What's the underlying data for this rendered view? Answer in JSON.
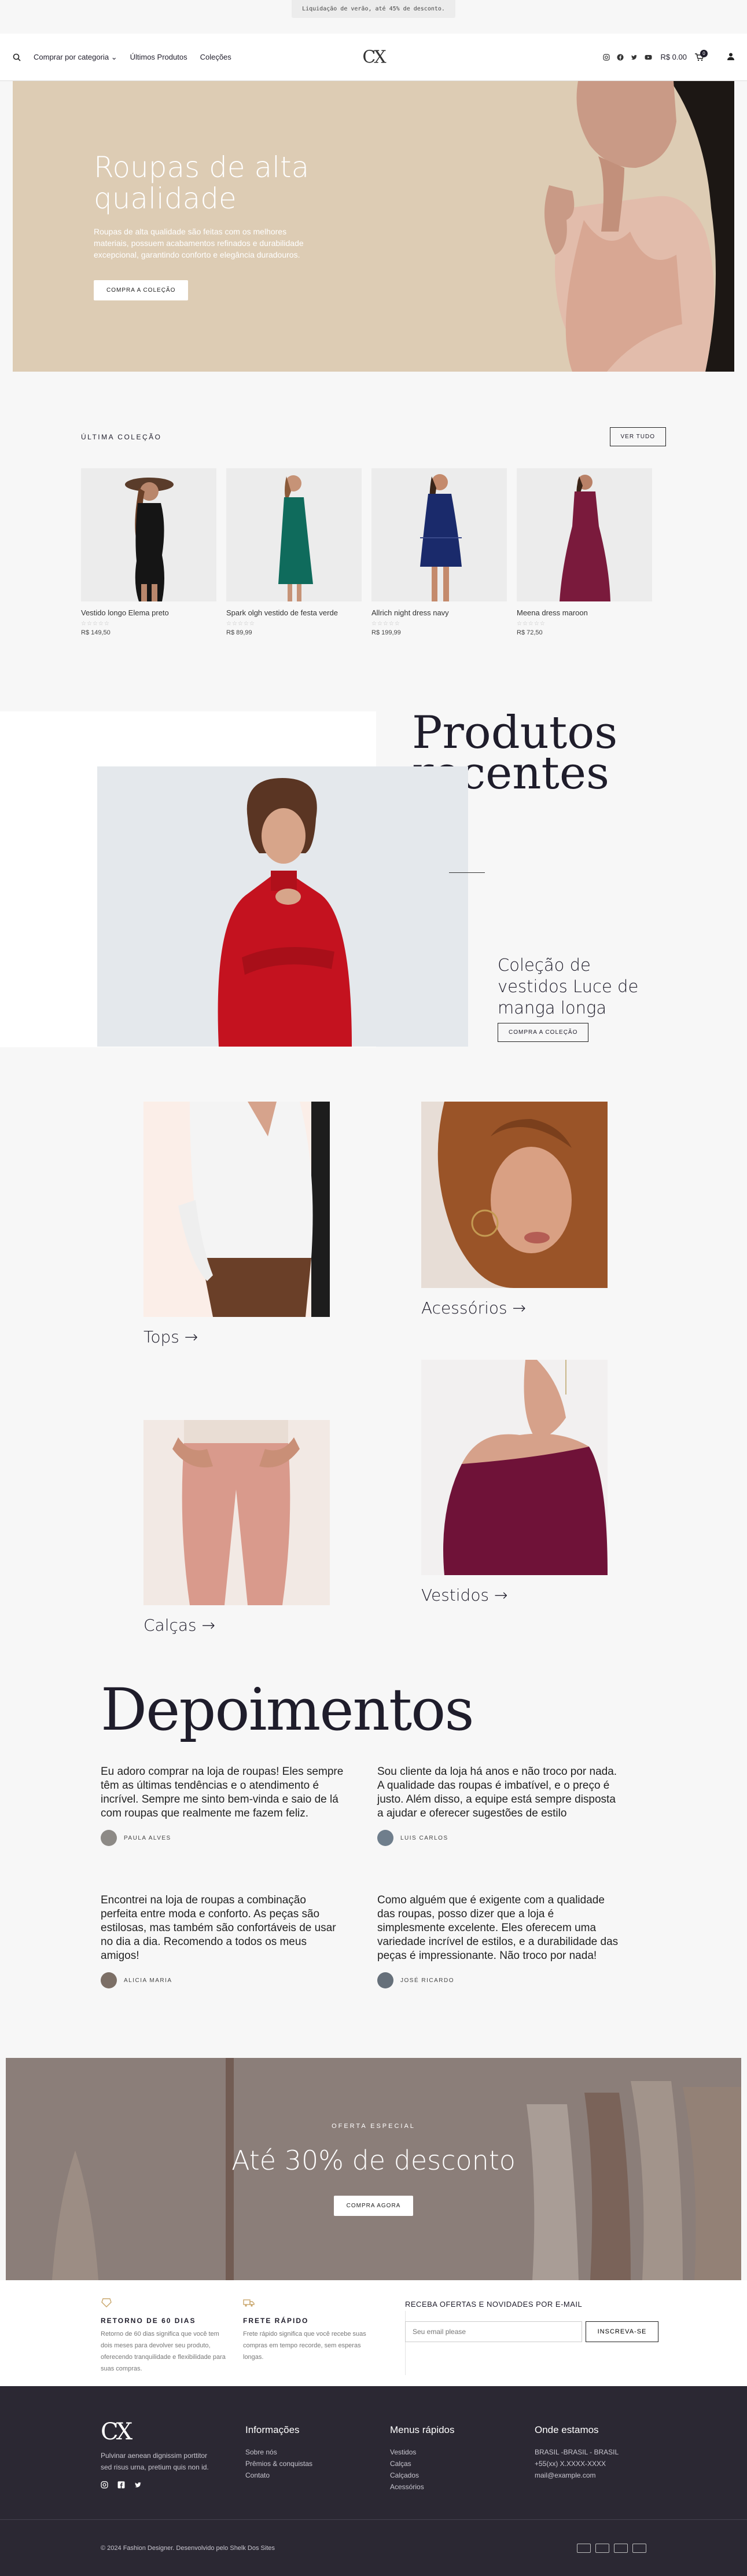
{
  "promo": {
    "text": "Liquidação de verão, até 45% de desconto."
  },
  "header": {
    "nav": [
      "Comprar por categoria",
      "Últimos Produtos",
      "Coleções"
    ],
    "logo": "CX",
    "cart_total": "R$ 0.00",
    "cart_count": "0"
  },
  "hero": {
    "title": "Roupas de alta qualidade",
    "text": "Roupas de alta qualidade são feitas com os melhores materiais, possuem acabamentos refinados e durabilidade excepcional, garantindo conforto e elegância duradouros.",
    "button": "COMPRA A COLEÇÃO"
  },
  "latest": {
    "heading": "ÚLTIMA COLEÇÃO",
    "button": "VER TUDO",
    "stars": "☆☆☆☆☆",
    "products": [
      {
        "name": "Vestido longo Elema preto",
        "price": "R$ 149,50"
      },
      {
        "name": "Spark olgh vestido de festa verde",
        "price": "R$ 89,99"
      },
      {
        "name": "Allrich night dress navy",
        "price": "R$ 199,99"
      },
      {
        "name": "Meena dress maroon",
        "price": "R$ 72,50"
      }
    ]
  },
  "recent": {
    "title": "Produtos recentes",
    "collection": "Coleção de vestidos Luce de manga longa",
    "button": "COMPRA A COLEÇÃO"
  },
  "categories": {
    "tops": "Tops →",
    "accessories": "Acessórios →",
    "pants": "Calças →",
    "dresses": "Vestidos →"
  },
  "testimonials": {
    "title": "Depoimentos",
    "items": [
      {
        "text": "Eu adoro comprar na loja de roupas! Eles sempre têm as últimas tendências e o atendimento é incrível. Sempre me sinto bem-vinda e saio de lá com roupas que realmente me fazem feliz.",
        "author": "PAULA ALVES"
      },
      {
        "text": "Sou cliente da loja há anos e não troco por nada. A qualidade das roupas é imbatível, e o preço é justo. Além disso, a equipe está sempre disposta a ajudar e oferecer sugestões de estilo",
        "author": "LUIS CARLOS"
      },
      {
        "text": "Encontrei na loja de roupas a combinação perfeita entre moda e conforto. As peças são estilosas, mas também são confortáveis de usar no dia a dia. Recomendo a todos os meus amigos!",
        "author": "ALICIA MARIA"
      },
      {
        "text": "Como alguém que é exigente com a qualidade das roupas, posso dizer que a loja é simplesmente excelente. Eles oferecem uma variedade incrível de estilos, e a durabilidade das peças é impressionante. Não troco por nada!",
        "author": "JOSÉ RICARDO"
      }
    ]
  },
  "offer": {
    "small": "OFERTA ESPECIAL",
    "title": "Até 30% de desconto",
    "button": "COMPRA AGORA"
  },
  "features": [
    {
      "title": "RETORNO DE 60 DIAS",
      "text": "Retorno de 60 dias significa que você tem dois meses para devolver seu produto, oferecendo tranquilidade e flexibilidade para suas compras."
    },
    {
      "title": "FRETE RÁPIDO",
      "text": "Frete rápido significa que você recebe suas compras em tempo recorde, sem esperas longas."
    }
  ],
  "newsletter": {
    "title": "RECEBA OFERTAS E NOVIDADES POR E-MAIL",
    "placeholder": "Seu email please",
    "button": "INSCREVA-SE"
  },
  "footer": {
    "logo": "CX",
    "about": "Pulvinar aenean dignissim porttitor sed risus urna, pretium quis non id.",
    "info_title": "Informações",
    "info_links": [
      "Sobre nós",
      "Prêmios & conquistas",
      "Contato"
    ],
    "quick_title": "Menus rápidos",
    "quick_links": [
      "Vestidos",
      "Calças",
      "Calçados",
      "Acessórios"
    ],
    "where_title": "Onde estamos",
    "where_lines": [
      "BRASIL -BRASIL - BRASIL",
      "+55(xx) X.XXXX-XXXX",
      "mail@example.com"
    ],
    "copyright": "© 2024 Fashion Designer. Desenvolvido pelo Shelk Dos Sites"
  },
  "colors": {
    "hero_bg": "#ddccb4",
    "dark": "#2b2833",
    "text": "#1f1d2b"
  }
}
